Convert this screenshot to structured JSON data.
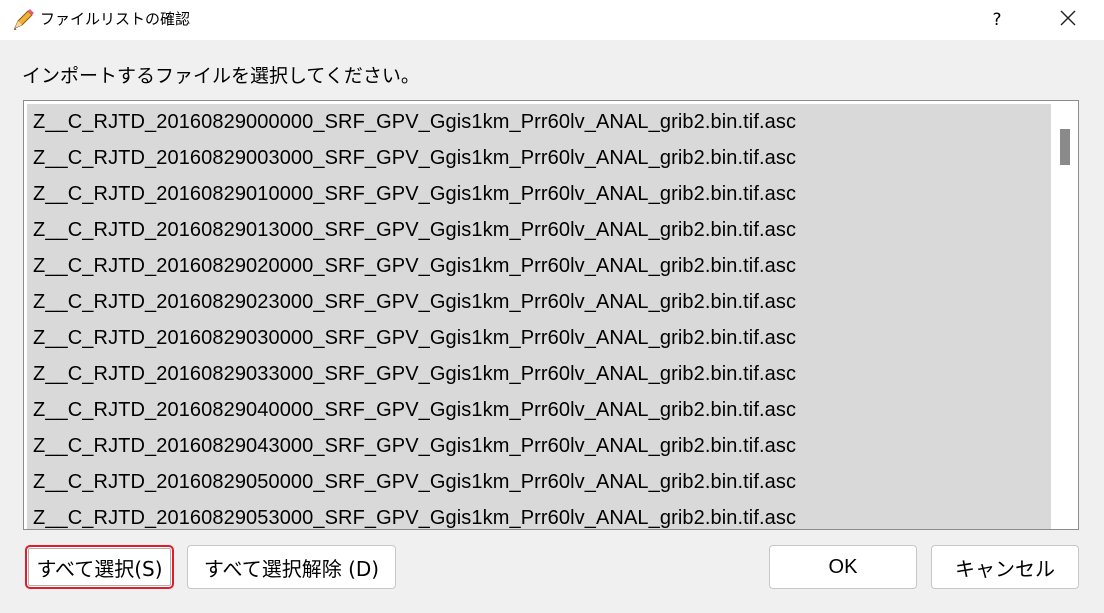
{
  "window": {
    "title": "ファイルリストの確認",
    "help_label": "?",
    "title_icon": "pencil-icon",
    "close_icon": "close-icon"
  },
  "prompt": "インポートするファイルを選択してください。",
  "files": [
    "Z__C_RJTD_20160829000000_SRF_GPV_Ggis1km_Prr60lv_ANAL_grib2.bin.tif.asc",
    "Z__C_RJTD_20160829003000_SRF_GPV_Ggis1km_Prr60lv_ANAL_grib2.bin.tif.asc",
    "Z__C_RJTD_20160829010000_SRF_GPV_Ggis1km_Prr60lv_ANAL_grib2.bin.tif.asc",
    "Z__C_RJTD_20160829013000_SRF_GPV_Ggis1km_Prr60lv_ANAL_grib2.bin.tif.asc",
    "Z__C_RJTD_20160829020000_SRF_GPV_Ggis1km_Prr60lv_ANAL_grib2.bin.tif.asc",
    "Z__C_RJTD_20160829023000_SRF_GPV_Ggis1km_Prr60lv_ANAL_grib2.bin.tif.asc",
    "Z__C_RJTD_20160829030000_SRF_GPV_Ggis1km_Prr60lv_ANAL_grib2.bin.tif.asc",
    "Z__C_RJTD_20160829033000_SRF_GPV_Ggis1km_Prr60lv_ANAL_grib2.bin.tif.asc",
    "Z__C_RJTD_20160829040000_SRF_GPV_Ggis1km_Prr60lv_ANAL_grib2.bin.tif.asc",
    "Z__C_RJTD_20160829043000_SRF_GPV_Ggis1km_Prr60lv_ANAL_grib2.bin.tif.asc",
    "Z__C_RJTD_20160829050000_SRF_GPV_Ggis1km_Prr60lv_ANAL_grib2.bin.tif.asc",
    "Z__C_RJTD_20160829053000_SRF_GPV_Ggis1km_Prr60lv_ANAL_grib2.bin.tif.asc"
  ],
  "buttons": {
    "select_all": "すべて選択(S)",
    "deselect_all": "すべて選択解除 (D)",
    "ok": "OK",
    "cancel": "キャンセル"
  },
  "colors": {
    "selected_row": "#d9d9d9",
    "focus_ring": "#e11d2b"
  }
}
